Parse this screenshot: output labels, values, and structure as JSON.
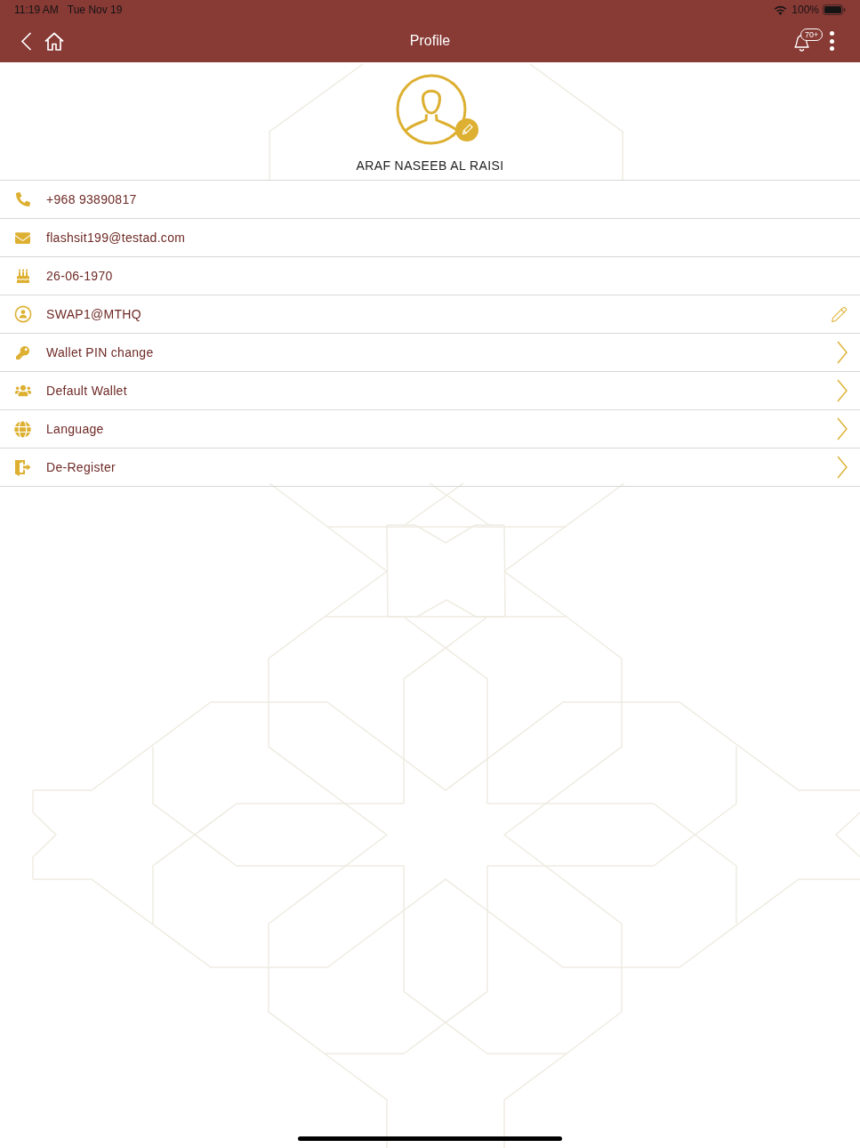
{
  "status_bar": {
    "time": "11:19 AM",
    "date": "Tue Nov 19",
    "battery_text": "100%"
  },
  "nav_bar": {
    "title": "Profile",
    "notification_count": "70+"
  },
  "profile": {
    "name": "ARAF NASEEB AL RAISI"
  },
  "rows": [
    {
      "kind": "info",
      "text": "+968 93890817"
    },
    {
      "kind": "info",
      "text": "flashsit199@testad.com"
    },
    {
      "kind": "info",
      "text": "26-06-1970"
    },
    {
      "kind": "editable",
      "text": "SWAP1@MTHQ"
    },
    {
      "kind": "link",
      "text": "Wallet PIN change"
    },
    {
      "kind": "link",
      "text": "Default Wallet"
    },
    {
      "kind": "link",
      "text": "Language"
    },
    {
      "kind": "link",
      "text": "De-Register"
    }
  ]
}
